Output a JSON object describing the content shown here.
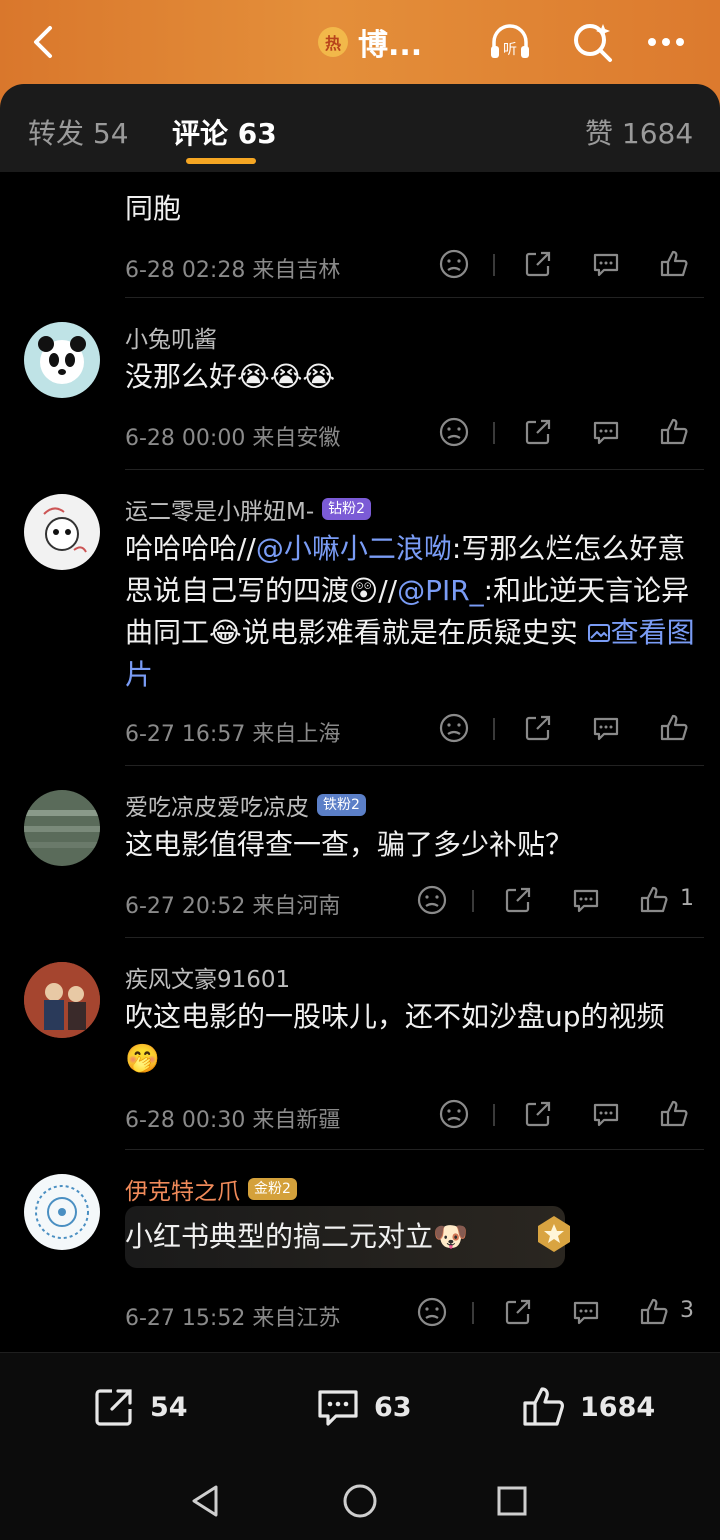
{
  "header": {
    "title": "博...",
    "hot_badge": "热",
    "accent": "#e48f3a"
  },
  "tabs": [
    {
      "label": "转发 54"
    },
    {
      "label": "评论 63"
    },
    {
      "label": "赞 1684"
    }
  ],
  "comments": [
    {
      "text_tail": "同胞",
      "time": "6-28 02:28",
      "location": "来自吉林",
      "likes": ""
    },
    {
      "name": "小兔叽酱",
      "text": "没那么好😭😭😭",
      "time": "6-28 00:00",
      "location": "来自安徽",
      "likes": ""
    },
    {
      "name": "运二零是小胖妞M-",
      "badge": "钻粉2",
      "text_pre": "哈哈哈哈//",
      "mention1": "@小嘛小二浪呦",
      "text_mid": ":写那么烂怎么好意思说自己写的四渡😲//",
      "mention2": "@PIR_",
      "text_post": ":和此逆天言论异曲同工😂说电影难看就是在质疑史实",
      "pic_link": "查看图片",
      "time": "6-27 16:57",
      "location": "来自上海",
      "likes": ""
    },
    {
      "name": "爱吃凉皮爱吃凉皮",
      "badge": "铁粉2",
      "text": "这电影值得查一查，骗了多少补贴？",
      "time": "6-27 20:52",
      "location": "来自河南",
      "likes": "1"
    },
    {
      "name": "疾风文豪91601",
      "text": "吹这电影的一股味儿，还不如沙盘up的视频🤭",
      "time": "6-28 00:30",
      "location": "来自新疆",
      "likes": ""
    },
    {
      "name": "伊克特之爪",
      "badge": "金粉2",
      "text": "小红书典型的搞二元对立🐶",
      "time": "6-27 15:52",
      "location": "来自江苏",
      "likes": "3"
    }
  ],
  "bottom_bar": {
    "reposts": "54",
    "comments": "63",
    "likes": "1684"
  }
}
